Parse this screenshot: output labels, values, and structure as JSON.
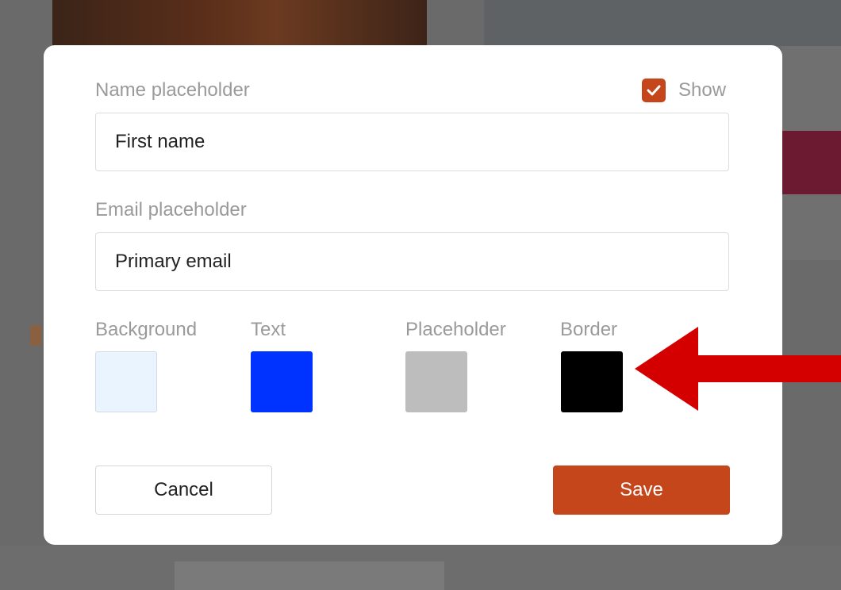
{
  "form": {
    "name": {
      "label": "Name placeholder",
      "value": "First name",
      "show_label": "Show",
      "show_checked": true
    },
    "email": {
      "label": "Email placeholder",
      "value": "Primary email"
    }
  },
  "colors": [
    {
      "label": "Background",
      "value": "#eaf4ff"
    },
    {
      "label": "Text",
      "value": "#0033ff"
    },
    {
      "label": "Placeholder",
      "value": "#bdbdbd"
    },
    {
      "label": "Border",
      "value": "#000000"
    }
  ],
  "buttons": {
    "cancel": "Cancel",
    "save": "Save"
  },
  "theme": {
    "accent": "#c4461a",
    "annotation_arrow": "#d40000"
  },
  "annotation": {
    "icon": "red-arrow-left-icon",
    "points_to": "Border"
  }
}
